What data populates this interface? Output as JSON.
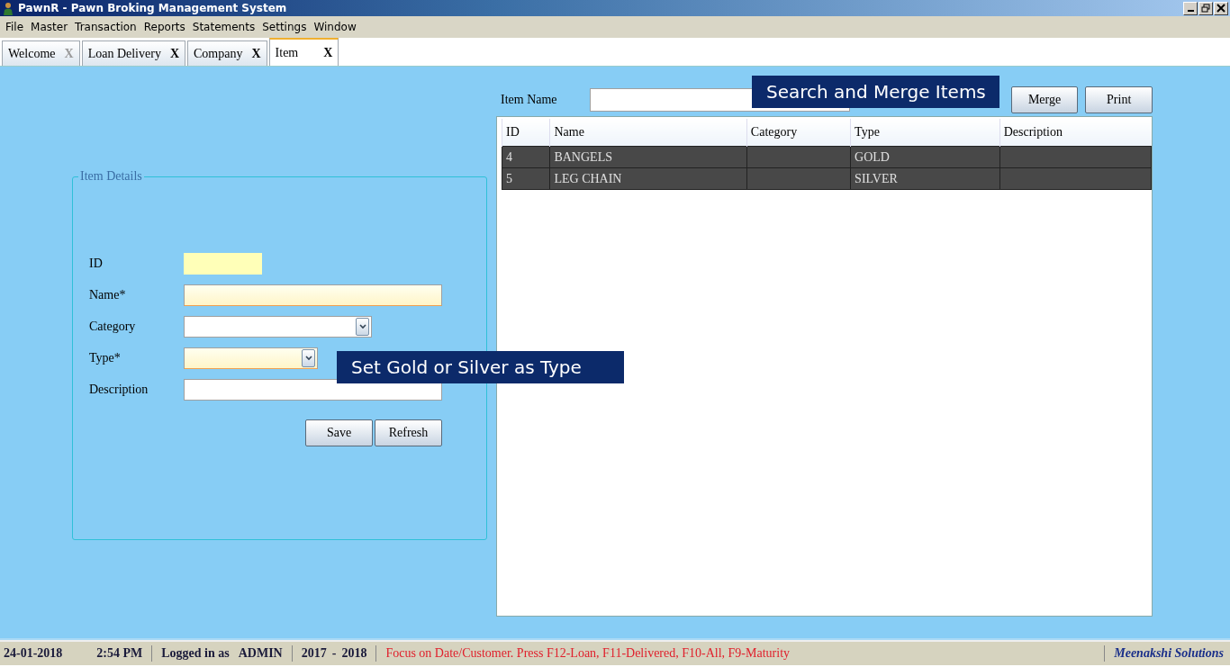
{
  "window": {
    "title": "PawnR - Pawn Broking Management System"
  },
  "menu": [
    "File",
    "Master",
    "Transaction",
    "Reports",
    "Statements",
    "Settings",
    "Window"
  ],
  "tabs": [
    {
      "label": "Welcome",
      "close": "X",
      "close_enabled": false,
      "selected": false
    },
    {
      "label": "Loan Delivery",
      "close": "X",
      "close_enabled": true,
      "selected": false
    },
    {
      "label": "Company",
      "close": "X",
      "close_enabled": true,
      "selected": false
    },
    {
      "label": "Item",
      "close": "X",
      "close_enabled": true,
      "selected": true
    }
  ],
  "item_details": {
    "title": "Item Details",
    "fields": [
      {
        "label": "ID",
        "kind": "readonly",
        "required": false
      },
      {
        "label": "Name*",
        "kind": "text",
        "required": true
      },
      {
        "label": "Category",
        "kind": "select",
        "required": false
      },
      {
        "label": "Type*",
        "kind": "select",
        "required": true
      },
      {
        "label": "Description",
        "kind": "text",
        "required": false
      }
    ],
    "buttons": [
      "Save",
      "Refresh"
    ]
  },
  "search": {
    "label": "Item Name",
    "buttons": [
      "Merge",
      "Print"
    ]
  },
  "table": {
    "columns": [
      "ID",
      "Name",
      "Category",
      "Type",
      "Description"
    ],
    "rows": [
      [
        "4",
        "BANGELS",
        "",
        "GOLD",
        ""
      ],
      [
        "5",
        "LEG CHAIN",
        "",
        "SILVER",
        ""
      ]
    ]
  },
  "callouts": [
    {
      "text": "Search and Merge Items",
      "kind": "search"
    },
    {
      "text": "Set Gold or Silver as Type",
      "kind": "type"
    }
  ],
  "status_bar": {
    "date": "24-01-2018",
    "time": "2:54 PM",
    "login_label": "Logged in as",
    "user": "ADMIN",
    "year_from": "2017",
    "year_sep": "-",
    "year_to": "2018",
    "message": "Focus on Date/Customer. Press F12-Loan, F11-Delivered, F10-All, F9-Maturity",
    "company": "Meenakshi Solutions"
  }
}
